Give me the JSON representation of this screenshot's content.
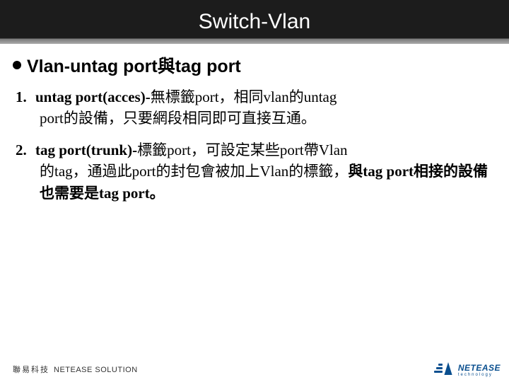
{
  "title": "Switch-Vlan",
  "section_title": "Vlan-untag port與tag port",
  "items": [
    {
      "num": "1.",
      "lead": "untag port(acces)-",
      "body1": "無標籤port，相同vlan的untag",
      "body2": "port的設備，只要網段相同即可直接互通。"
    },
    {
      "num": "2.",
      "lead": "tag port(trunk)-",
      "body1": "標籤port，可設定某些port帶Vlan",
      "body2": "的tag，通過此port的封包會被加上Vlan的標籤，",
      "bold_tail": "與tag port相接的設備也需要是tag port。"
    }
  ],
  "footer": {
    "brand": "聯易科技",
    "sub": "NETEASE SOLUTION"
  },
  "logo": {
    "l1": "NETEASE",
    "l2": "technology"
  }
}
